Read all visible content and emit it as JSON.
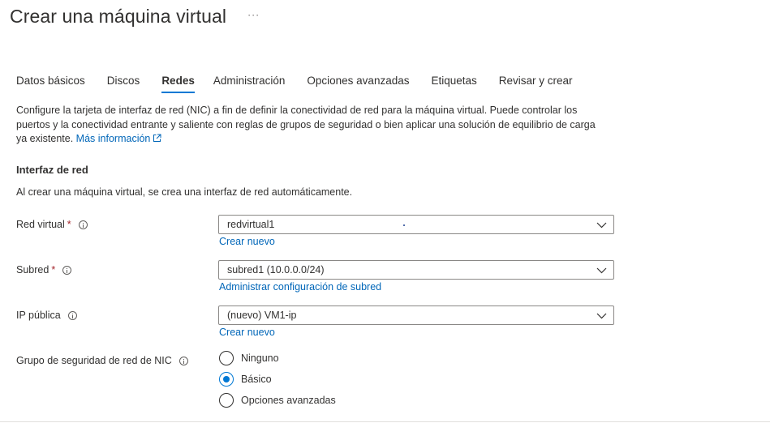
{
  "header": {
    "title": "Crear una máquina virtual",
    "more_label": "···"
  },
  "tabs": [
    {
      "label": "Datos básicos",
      "active": false
    },
    {
      "label": "Discos",
      "active": false
    },
    {
      "label": "Redes",
      "active": true
    },
    {
      "label": "Administración",
      "active": false
    },
    {
      "label": "Opciones avanzadas",
      "active": false
    },
    {
      "label": "Etiquetas",
      "active": false
    },
    {
      "label": "Revisar y crear",
      "active": false
    }
  ],
  "description": {
    "text": "Configure la tarjeta de interfaz de red (NIC) a fin de definir la conectividad de red para la máquina virtual. Puede controlar los puertos y la conectividad entrante y saliente con reglas de grupos de seguridad o bien aplicar una solución de equilibrio de carga ya existente.",
    "link_text": "Más información"
  },
  "network_interface": {
    "title": "Interfaz de red",
    "description": "Al crear una máquina virtual, se crea una interfaz de red automáticamente.",
    "fields": {
      "virtual_network": {
        "label": "Red virtual",
        "required_mark": "*",
        "value": "redvirtual1",
        "link": "Crear nuevo"
      },
      "subnet": {
        "label": "Subred",
        "required_mark": "*",
        "value": "subred1 (10.0.0.0/24)",
        "link": "Administrar configuración de subred"
      },
      "public_ip": {
        "label": "IP pública",
        "value": "(nuevo) VM1-ip",
        "link": "Crear nuevo"
      },
      "nic_nsg": {
        "label": "Grupo de seguridad de red de NIC",
        "options": [
          {
            "label": "Ninguno",
            "selected": false
          },
          {
            "label": "Básico",
            "selected": true
          },
          {
            "label": "Opciones avanzadas",
            "selected": false
          }
        ]
      }
    }
  },
  "colors": {
    "accent": "#0078d4",
    "link": "#0066b8",
    "required": "#a4262c",
    "text": "#323130",
    "border": "#8a8886"
  },
  "icons": {
    "title_more": "more-icon",
    "external_link": "external-link-icon",
    "info": "info-icon",
    "dropdown": "chevron-down-icon"
  }
}
